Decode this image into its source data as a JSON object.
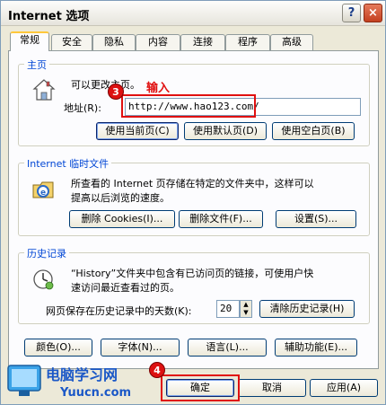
{
  "window": {
    "title": "Internet 选项",
    "help": "?",
    "close": "×"
  },
  "tabs": [
    "常规",
    "安全",
    "隐私",
    "内容",
    "连接",
    "程序",
    "高级"
  ],
  "home": {
    "group_title": "主页",
    "desc": "可以更改主页。",
    "address_label": "地址(R):",
    "address_value": "http://www.hao123.com/",
    "buttons": [
      "使用当前页(C)",
      "使用默认页(D)",
      "使用空白页(B)"
    ]
  },
  "temp": {
    "group_title": "Internet 临时文件",
    "desc_line1": "所查看的 Internet 页存储在特定的文件夹中，这样可以",
    "desc_line2": "提高以后浏览的速度。",
    "buttons": [
      "删除 Cookies(I)...",
      "删除文件(F)...",
      "设置(S)..."
    ]
  },
  "history": {
    "group_title": "历史记录",
    "desc_line1": "“History”文件夹中包含有已访问页的链接，可使用户快",
    "desc_line2": "速访问最近查看过的页。",
    "days_label": "网页保存在历史记录中的天数(K):",
    "days_value": "20",
    "clear_button": "清除历史记录(H)"
  },
  "bottom_buttons": [
    "颜色(O)...",
    "字体(N)...",
    "语言(L)...",
    "辅助功能(E)..."
  ],
  "dialog_buttons": {
    "ok": "确定",
    "cancel": "取消",
    "apply": "应用(A)"
  },
  "annotations": {
    "step3": "3",
    "step3_text": "输入",
    "step4": "4"
  },
  "logo": {
    "cn": "电脑学习网",
    "en": "Yuucn.com"
  }
}
